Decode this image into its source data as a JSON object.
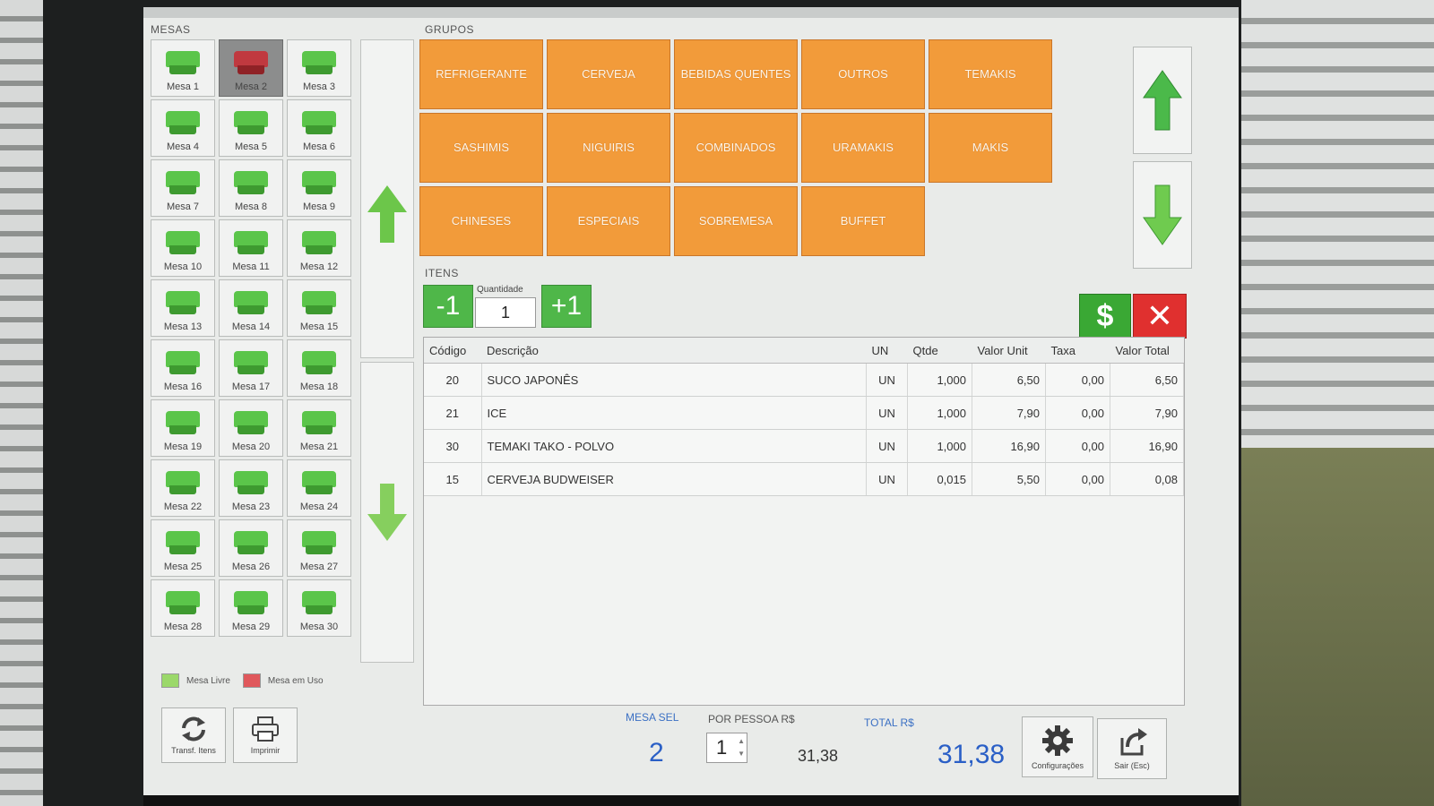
{
  "sections": {
    "mesas": "MESAS",
    "grupos": "GRUPOS",
    "itens": "ITENS"
  },
  "mesas": [
    {
      "label": "Mesa 1",
      "status": "livre"
    },
    {
      "label": "Mesa 2",
      "status": "em_uso"
    },
    {
      "label": "Mesa 3",
      "status": "livre"
    },
    {
      "label": "Mesa 4",
      "status": "livre"
    },
    {
      "label": "Mesa 5",
      "status": "livre"
    },
    {
      "label": "Mesa 6",
      "status": "livre"
    },
    {
      "label": "Mesa 7",
      "status": "livre"
    },
    {
      "label": "Mesa 8",
      "status": "livre"
    },
    {
      "label": "Mesa 9",
      "status": "livre"
    },
    {
      "label": "Mesa 10",
      "status": "livre"
    },
    {
      "label": "Mesa 11",
      "status": "livre"
    },
    {
      "label": "Mesa 12",
      "status": "livre"
    },
    {
      "label": "Mesa 13",
      "status": "livre"
    },
    {
      "label": "Mesa 14",
      "status": "livre"
    },
    {
      "label": "Mesa 15",
      "status": "livre"
    },
    {
      "label": "Mesa 16",
      "status": "livre"
    },
    {
      "label": "Mesa 17",
      "status": "livre"
    },
    {
      "label": "Mesa 18",
      "status": "livre"
    },
    {
      "label": "Mesa 19",
      "status": "livre"
    },
    {
      "label": "Mesa 20",
      "status": "livre"
    },
    {
      "label": "Mesa 21",
      "status": "livre"
    },
    {
      "label": "Mesa 22",
      "status": "livre"
    },
    {
      "label": "Mesa 23",
      "status": "livre"
    },
    {
      "label": "Mesa 24",
      "status": "livre"
    },
    {
      "label": "Mesa 25",
      "status": "livre"
    },
    {
      "label": "Mesa 26",
      "status": "livre"
    },
    {
      "label": "Mesa 27",
      "status": "livre"
    },
    {
      "label": "Mesa 28",
      "status": "livre"
    },
    {
      "label": "Mesa 29",
      "status": "livre"
    },
    {
      "label": "Mesa 30",
      "status": "livre"
    }
  ],
  "legend": {
    "livre": "Mesa Livre",
    "em_uso": "Mesa em Uso"
  },
  "colors": {
    "livre": "#9bd86a",
    "em_uso": "#e0585c",
    "group": "#f29b3a",
    "accent_blue": "#2a5fc6"
  },
  "grupos": [
    "REFRIGERANTE",
    "CERVEJA",
    "BEBIDAS QUENTES",
    "OUTROS",
    "TEMAKIS",
    "SASHIMIS",
    "NIGUIRIS",
    "COMBINADOS",
    "URAMAKIS",
    "MAKIS",
    "CHINESES",
    "ESPECIAIS",
    "SOBREMESA",
    "BUFFET"
  ],
  "quantidade": {
    "label": "Quantidade",
    "value": "1",
    "minus": "-1",
    "plus": "+1"
  },
  "actions": {
    "pay": "$",
    "cancel": "✕"
  },
  "itens_table": {
    "headers": [
      "Código",
      "Descrição",
      "UN",
      "Qtde",
      "Valor Unit",
      "Taxa",
      "Valor Total"
    ],
    "rows": [
      [
        "20",
        "SUCO JAPONÊS",
        "UN",
        "1,000",
        "6,50",
        "0,00",
        "6,50"
      ],
      [
        "21",
        "ICE",
        "UN",
        "1,000",
        "7,90",
        "0,00",
        "7,90"
      ],
      [
        "30",
        "TEMAKI TAKO - POLVO",
        "UN",
        "1,000",
        "16,90",
        "0,00",
        "16,90"
      ],
      [
        "15",
        "CERVEJA BUDWEISER",
        "UN",
        "0,015",
        "5,50",
        "0,00",
        "0,08"
      ]
    ]
  },
  "footer": {
    "transf_label": "Transf. Itens",
    "imprimir_label": "Imprimir",
    "mesa_sel_label": "MESA SEL",
    "mesa_sel_value": "2",
    "por_pessoa_label": "POR PESSOA R$",
    "pessoas_value": "1",
    "por_pessoa_value": "31,38",
    "total_label": "TOTAL R$",
    "total_value": "31,38",
    "config_label": "Configurações",
    "sair_label": "Sair (Esc)"
  }
}
